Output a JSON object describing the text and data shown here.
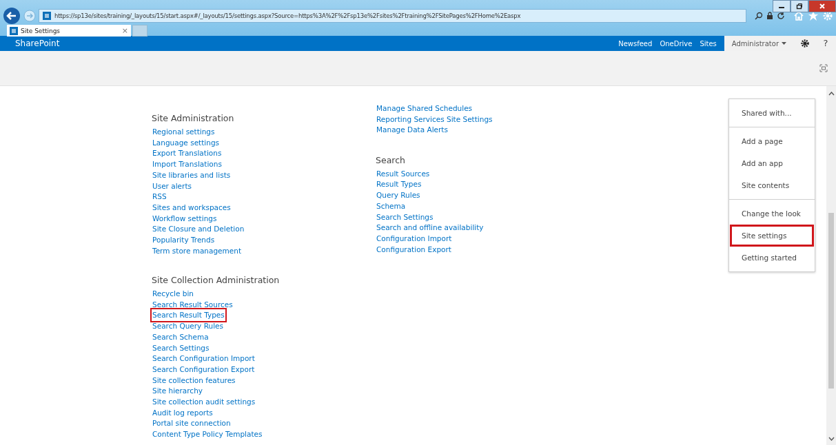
{
  "browser": {
    "url": "https://sp13e/sites/training/_layouts/15/start.aspx#/_layouts/15/settings.aspx?Source=https%3A%2F%2Fsp13e%2Fsites%2Ftraining%2FSitePages%2FHome%2Easpx",
    "tabs": [
      {
        "title": "Site Settings",
        "close": "×",
        "selected": true
      }
    ]
  },
  "suite_bar": {
    "brand": "SharePoint",
    "links": [
      "Newsfeed",
      "OneDrive",
      "Sites"
    ],
    "user": "Administrator",
    "help": "?"
  },
  "columns": [
    [
      {
        "title": "Site Administration",
        "links": [
          {
            "label": "Regional settings",
            "highlighted": false
          },
          {
            "label": "Language settings",
            "highlighted": false
          },
          {
            "label": "Export Translations",
            "highlighted": false
          },
          {
            "label": "Import Translations",
            "highlighted": false
          },
          {
            "label": "Site libraries and lists",
            "highlighted": false
          },
          {
            "label": "User alerts",
            "highlighted": false
          },
          {
            "label": "RSS",
            "highlighted": false
          },
          {
            "label": "Sites and workspaces",
            "highlighted": false
          },
          {
            "label": "Workflow settings",
            "highlighted": false
          },
          {
            "label": "Site Closure and Deletion",
            "highlighted": false
          },
          {
            "label": "Popularity Trends",
            "highlighted": false
          },
          {
            "label": "Term store management",
            "highlighted": false
          }
        ]
      },
      {
        "title": "Site Collection Administration",
        "links": [
          {
            "label": "Recycle bin",
            "highlighted": false
          },
          {
            "label": "Search Result Sources",
            "highlighted": false
          },
          {
            "label": "Search Result Types",
            "highlighted": true
          },
          {
            "label": "Search Query Rules",
            "highlighted": false
          },
          {
            "label": "Search Schema",
            "highlighted": false
          },
          {
            "label": "Search Settings",
            "highlighted": false
          },
          {
            "label": "Search Configuration Import",
            "highlighted": false
          },
          {
            "label": "Search Configuration Export",
            "highlighted": false
          },
          {
            "label": "Site collection features",
            "highlighted": false
          },
          {
            "label": "Site hierarchy",
            "highlighted": false
          },
          {
            "label": "Site collection audit settings",
            "highlighted": false
          },
          {
            "label": "Audit log reports",
            "highlighted": false
          },
          {
            "label": "Portal site connection",
            "highlighted": false
          },
          {
            "label": "Content Type Policy Templates",
            "highlighted": false
          }
        ]
      }
    ],
    [
      {
        "links": [
          {
            "label": "Manage Shared Schedules",
            "highlighted": false
          },
          {
            "label": "Reporting Services Site Settings",
            "highlighted": false
          },
          {
            "label": "Manage Data Alerts",
            "highlighted": false
          }
        ]
      },
      {
        "title": "Search",
        "links": [
          {
            "label": "Result Sources",
            "highlighted": false
          },
          {
            "label": "Result Types",
            "highlighted": false
          },
          {
            "label": "Query Rules",
            "highlighted": false
          },
          {
            "label": "Schema",
            "highlighted": false
          },
          {
            "label": "Search Settings",
            "highlighted": false
          },
          {
            "label": "Search and offline availability",
            "highlighted": false
          },
          {
            "label": "Configuration Import",
            "highlighted": false
          },
          {
            "label": "Configuration Export",
            "highlighted": false
          }
        ]
      }
    ]
  ],
  "settings_menu": [
    [
      {
        "label": "Shared with...",
        "highlighted": false
      }
    ],
    [
      {
        "label": "Add a page",
        "highlighted": false
      },
      {
        "label": "Add an app",
        "highlighted": false
      },
      {
        "label": "Site contents",
        "highlighted": false
      }
    ],
    [
      {
        "label": "Change the look",
        "highlighted": false
      },
      {
        "label": "Site settings",
        "highlighted": true
      },
      {
        "label": "Getting started",
        "highlighted": false
      }
    ]
  ]
}
